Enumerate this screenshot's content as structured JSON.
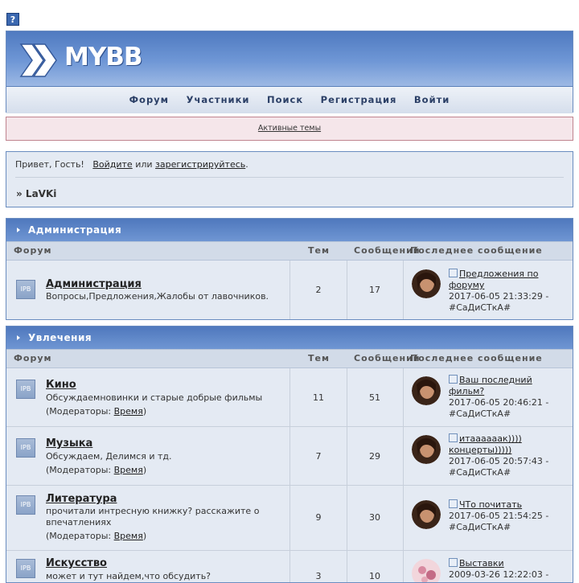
{
  "toolbar": {
    "help_label": "?"
  },
  "header": {
    "logo_text": "MYBB",
    "nav": [
      "Форум",
      "Участники",
      "Поиск",
      "Регистрация",
      "Войти"
    ]
  },
  "announcement": {
    "link": "Активные темы"
  },
  "welcome": {
    "greeting": "Привет, Гость!",
    "login_link": "Войдите",
    "or_text": "или",
    "register_link": "зарегистрируйтесь",
    "period": ".",
    "breadcrumb": "» LaVKi"
  },
  "columns": {
    "forum": "Форум",
    "topics": "Тем",
    "posts": "Сообщений",
    "last": "Последнее сообщение"
  },
  "categories": [
    {
      "title": "Администрация",
      "forums": [
        {
          "icon": "IPB",
          "name": "Администрация",
          "desc": "Вопросы,Предложения,Жалобы от лавочников.",
          "moderators_label": "",
          "moderator": "",
          "topics": "2",
          "posts": "17",
          "last_title": "Предложения по форуму",
          "last_date": "2017-06-05 21:33:29 -",
          "last_user": "#СаДиСТкА#"
        }
      ]
    },
    {
      "title": "Увлечения",
      "forums": [
        {
          "icon": "IPB",
          "name": "Кино",
          "desc": "Обсуждаемновинки и старые добрые фильмы",
          "moderators_label": "(Модераторы: ",
          "moderator": "Время",
          "topics": "11",
          "posts": "51",
          "last_title": "Ваш последний фильм?",
          "last_date": "2017-06-05 20:46:21 -",
          "last_user": "#СаДиСТкА#"
        },
        {
          "icon": "IPB",
          "name": "Музыка",
          "desc": "Обсуждаем, Делимся и тд.",
          "moderators_label": "(Модераторы: ",
          "moderator": "Время",
          "topics": "7",
          "posts": "29",
          "last_title": "итаааааак)))) концерты)))))",
          "last_date": "2017-06-05 20:57:43 -",
          "last_user": "#СаДиСТкА#"
        },
        {
          "icon": "IPB",
          "name": "Литература",
          "desc": "прочитали интресную книжку? расскажите о впечатлениях",
          "moderators_label": "(Модераторы: ",
          "moderator": "Время",
          "topics": "9",
          "posts": "30",
          "last_title": "ЧТо почитать",
          "last_date": "2017-06-05 21:54:25 -",
          "last_user": "#СаДиСТкА#"
        },
        {
          "icon": "IPB",
          "name": "Искусство",
          "desc": "может и тут найдем,что обсудить?",
          "moderators_label": "",
          "moderator": "",
          "topics": "3",
          "posts": "10",
          "last_title": "Выставки",
          "last_date": "2009-03-26 12:22:03 -",
          "last_user": ""
        }
      ]
    }
  ]
}
